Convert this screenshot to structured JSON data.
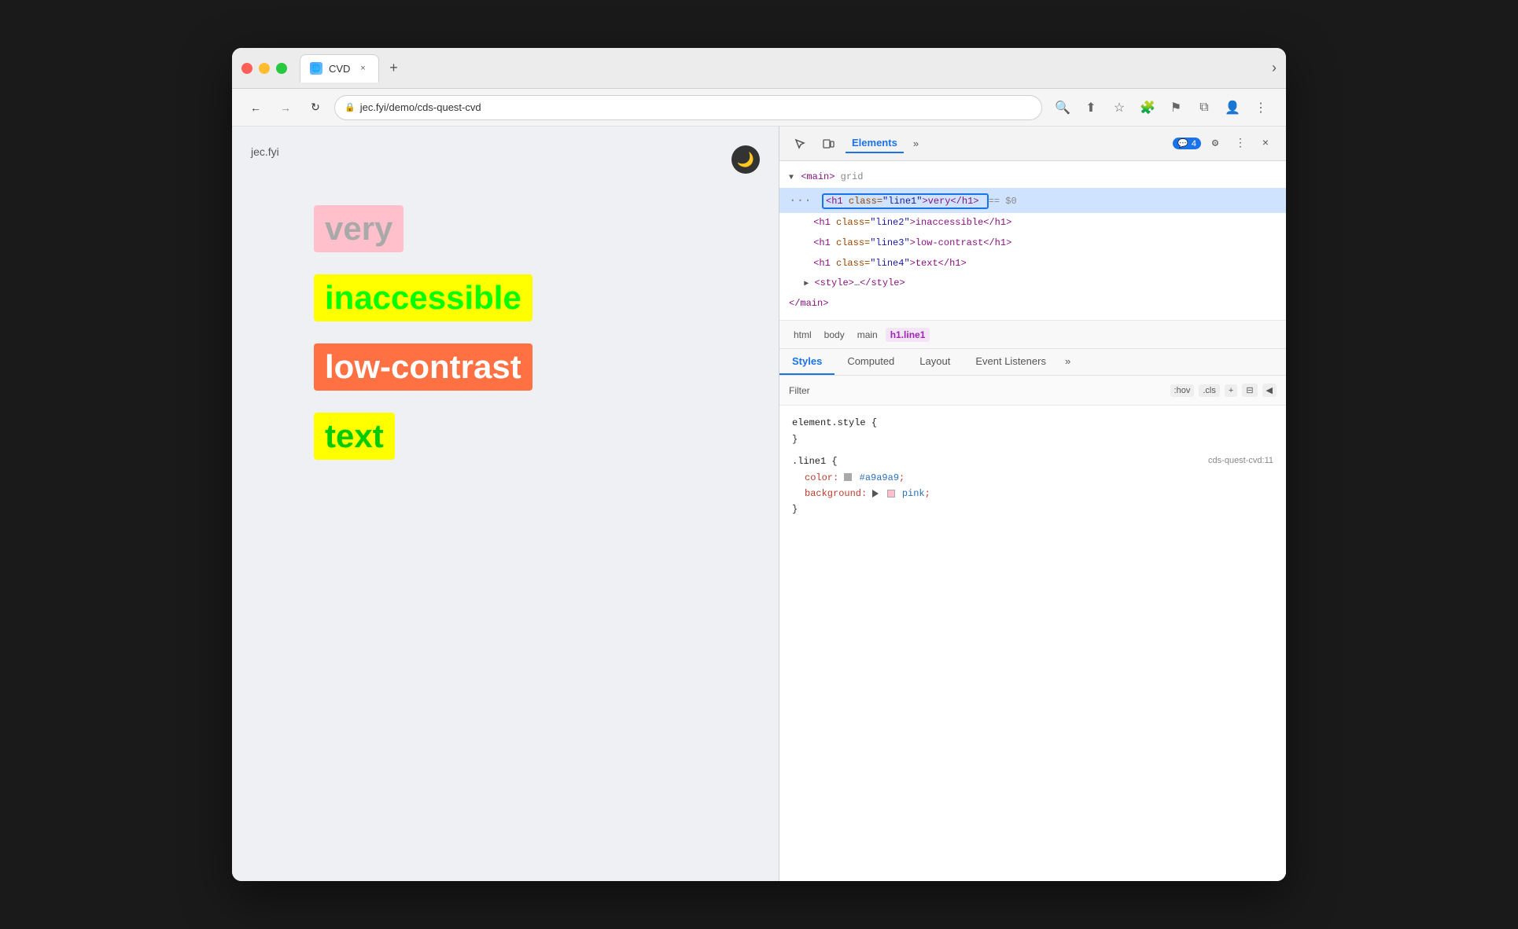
{
  "window": {
    "title": "CVD",
    "url": "jec.fyi/demo/cds-quest-cvd",
    "favicon": "🌐"
  },
  "browser": {
    "tab_label": "CVD",
    "tab_close": "×",
    "new_tab": "+",
    "more": "›",
    "back_btn": "←",
    "forward_btn": "→",
    "refresh_btn": "↻",
    "lock_icon": "🔒",
    "address": "jec.fyi/demo/cds-quest-cvd",
    "search_icon": "🔍",
    "share_icon": "⬆",
    "bookmark_icon": "☆",
    "extension_icon": "🧩",
    "flag_icon": "⚑",
    "split_icon": "⧉",
    "profile_icon": "👤",
    "menu_icon": "⋮",
    "window_more": "›"
  },
  "page": {
    "site_name": "jec.fyi",
    "dark_mode_btn": "🌙",
    "text_items": [
      {
        "text": "very",
        "class": "line1"
      },
      {
        "text": "inaccessible",
        "class": "line2"
      },
      {
        "text": "low-contrast",
        "class": "line3"
      },
      {
        "text": "text",
        "class": "line4"
      }
    ]
  },
  "devtools": {
    "toolbar": {
      "cursor_icon": "⊹",
      "copy_icon": "⧉",
      "elements_tab": "Elements",
      "more_tabs": "»",
      "badge_icon": "💬",
      "badge_count": "4",
      "settings_icon": "⚙",
      "more_menu": "⋮",
      "close": "×"
    },
    "dom_tree": {
      "rows": [
        {
          "indent": 0,
          "content": "▼ <main> grid",
          "type": "parent",
          "selected": false
        },
        {
          "indent": 1,
          "content": "<h1 class=\"line1\">very</h1>",
          "suffix": " == $0",
          "type": "element",
          "selected": true
        },
        {
          "indent": 1,
          "content": "<h1 class=\"line2\">inaccessible</h1>",
          "type": "element",
          "selected": false
        },
        {
          "indent": 1,
          "content": "<h1 class=\"line3\">low-contrast</h1>",
          "type": "element",
          "selected": false
        },
        {
          "indent": 1,
          "content": "<h1 class=\"line4\">text</h1>",
          "type": "element",
          "selected": false
        },
        {
          "indent": 1,
          "content": "▶ <style>…</style>",
          "type": "element",
          "selected": false
        },
        {
          "indent": 0,
          "content": "</main>",
          "type": "close",
          "selected": false
        }
      ]
    },
    "breadcrumbs": [
      "html",
      "body",
      "main",
      "h1.line1"
    ],
    "styles": {
      "tabs": [
        "Styles",
        "Computed",
        "Layout",
        "Event Listeners",
        "»"
      ],
      "active_tab": "Styles",
      "filter_placeholder": "Filter",
      "filter_buttons": [
        ":hov",
        ".cls",
        "+",
        "⊟",
        "◀"
      ],
      "css_blocks": [
        {
          "selector": "element.style {",
          "close": "}",
          "properties": []
        },
        {
          "selector": ".line1 {",
          "link": "cds-quest-cvd:11",
          "close": "}",
          "properties": [
            {
              "name": "color:",
              "value": "#a9a9a9",
              "swatch": "#a9a9a9",
              "swatch_type": "square"
            },
            {
              "name": "background:",
              "value": "pink",
              "swatch": "#ffb6c1",
              "swatch_type": "triangle"
            }
          ]
        }
      ]
    }
  }
}
